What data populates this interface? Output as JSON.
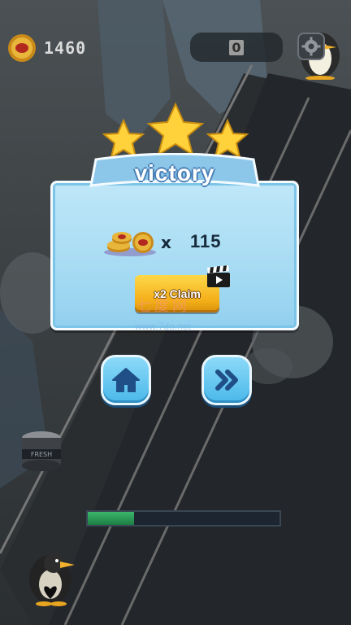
{
  "hud": {
    "coins": "1460",
    "score_box": "0"
  },
  "dialog": {
    "title": "victory",
    "stars": 3,
    "reward": {
      "multiplier_symbol": "x",
      "amount": "115"
    },
    "claim_label": "x2 Claim"
  },
  "buttons": {
    "home_icon": "home-icon",
    "next_icon": "chevron-double-right-icon"
  },
  "watermark": {
    "text": "七度网",
    "url": "www.7do.net"
  },
  "level_progress": 0.24,
  "can_label": "FRESH",
  "colors": {
    "panel": "#a6dbf3",
    "claim": "#f3ae18",
    "button": "#4ab8ea",
    "star": "#ffd23c"
  }
}
